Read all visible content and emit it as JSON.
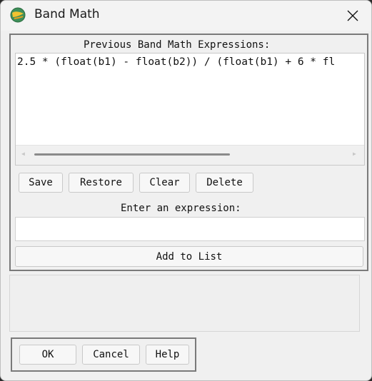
{
  "window": {
    "title": "Band Math",
    "icon": "globe-icon"
  },
  "expressions": {
    "header": "Previous Band Math Expressions:",
    "items": [
      "2.5 * (float(b1) - float(b2)) / (float(b1) + 6 * fl"
    ],
    "buttons": {
      "save": "Save",
      "restore": "Restore",
      "clear": "Clear",
      "delete": "Delete"
    }
  },
  "entry": {
    "label": "Enter an expression:",
    "value": "",
    "add_button": "Add to List"
  },
  "footer": {
    "ok": "OK",
    "cancel": "Cancel",
    "help": "Help"
  },
  "colors": {
    "window_bg": "#f0f0f0",
    "list_bg": "#ffffff",
    "group_border": "#7a7a7a"
  }
}
